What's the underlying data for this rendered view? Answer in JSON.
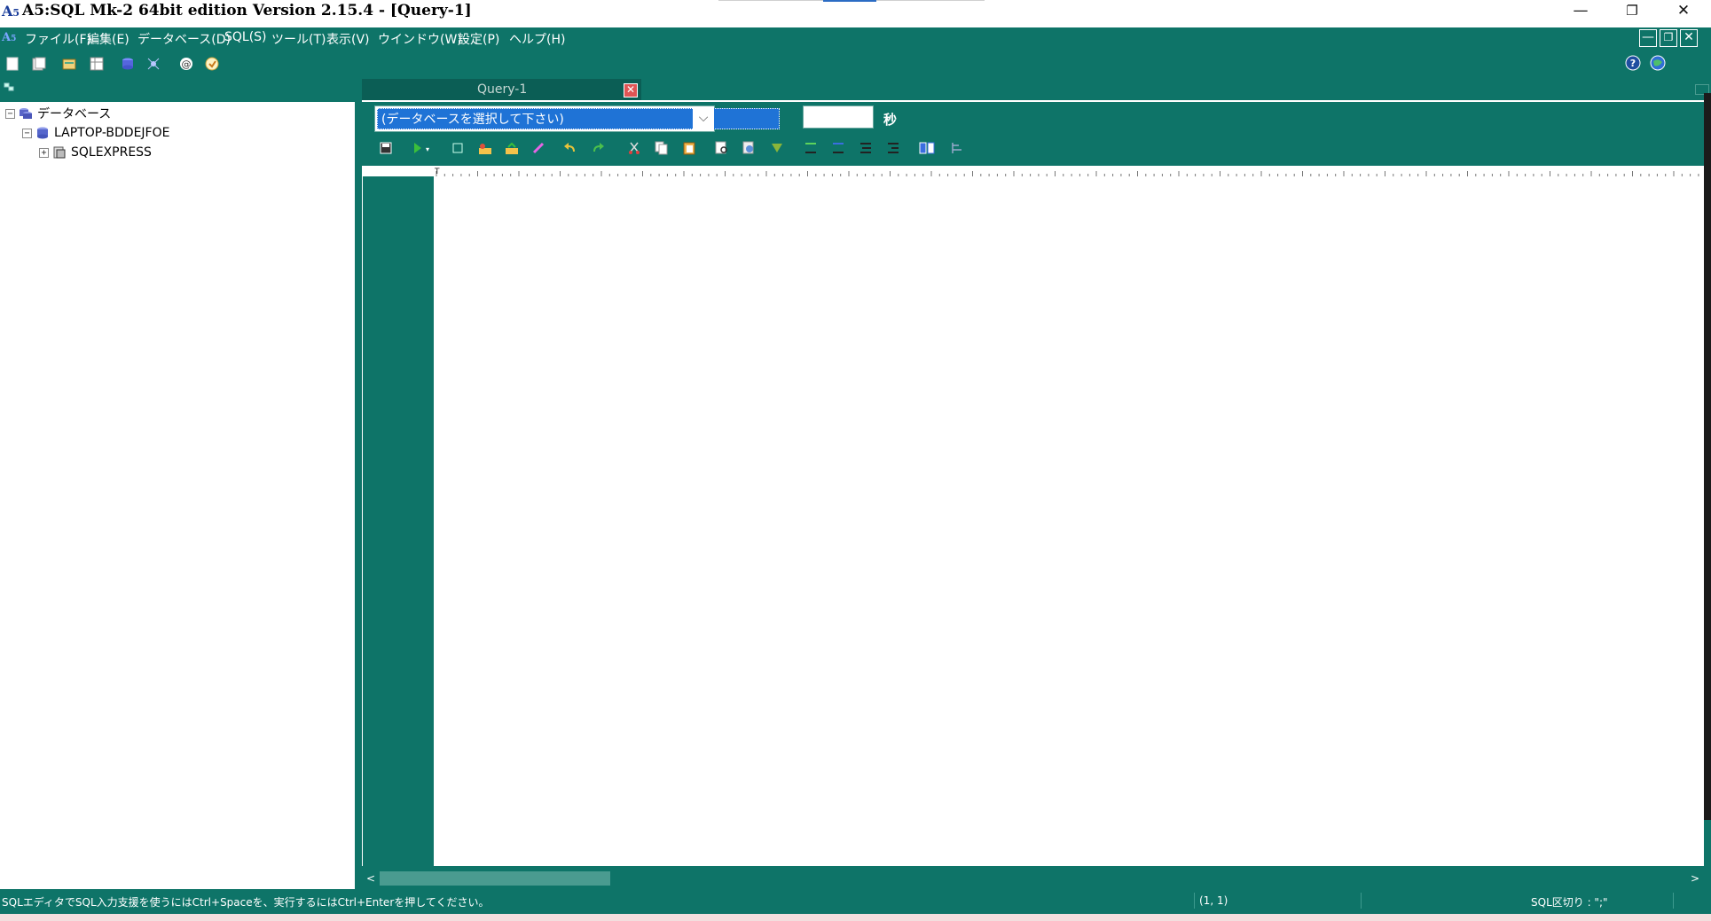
{
  "window": {
    "title": "A5:SQL Mk-2 64bit edition Version 2.15.4 - [Query-1]",
    "minimize_glyph": "—",
    "maximize_glyph": "❐",
    "close_glyph": "✕"
  },
  "menu": {
    "items": [
      "ファイル(F)",
      "編集(E)",
      "データベース(D)",
      "SQL(S)",
      "ツール(T)",
      "表示(V)",
      "ウインドウ(W)",
      "設定(P)",
      "ヘルプ(H)"
    ],
    "mdi_minimize_glyph": "—",
    "mdi_restore_glyph": "❐",
    "mdi_close_glyph": "✕"
  },
  "tree": {
    "root_label": "データベース",
    "server_label": "LAPTOP-BDDEJFOE",
    "instance_label": "SQLEXPRESS",
    "collapse_glyph": "−",
    "expand_glyph": "+"
  },
  "query_tab": {
    "label": "Query-1",
    "close_glyph": "✕"
  },
  "db_selector": {
    "selected": "(データベースを選択して下さい)",
    "arrow_glyph": "⌵"
  },
  "timeout": {
    "value": "",
    "unit_label": "秒"
  },
  "scrollbar": {
    "left_glyph": "<",
    "right_glyph": ">"
  },
  "status": {
    "hint": "SQLエディタでSQL入力支援を使うにはCtrl+Spaceを、実行するにはCtrl+Enterを押してください。",
    "position": "(1, 1)",
    "sql_delimiter": "SQL区切り : \";\""
  },
  "colors": {
    "chrome_teal": "#0e7468",
    "selection_blue": "#1f73d6",
    "tab_close_red": "#e05555"
  }
}
